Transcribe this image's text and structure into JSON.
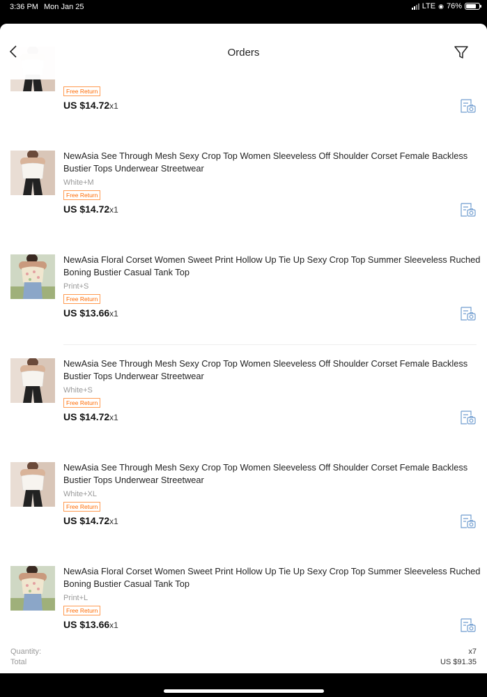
{
  "status_bar": {
    "time": "3:36 PM",
    "date": "Mon Jan 25",
    "network": "LTE",
    "battery": "76%",
    "battery_level": 0.76
  },
  "nav": {
    "title": "Orders",
    "back_icon": "chevron-left-icon",
    "filter_icon": "filter-funnel-icon"
  },
  "items": [
    {
      "title": "",
      "sku": "",
      "badge": "Free Return",
      "price": "US $14.72",
      "qty": "x1",
      "thumb": "white-corset"
    },
    {
      "title": "NewAsia See Through Mesh Sexy Crop Top Women Sleeveless Off Shoulder Corset Female Backless Bustier Tops Underwear Streetwear",
      "sku": "White+M",
      "badge": "Free Return",
      "price": "US $14.72",
      "qty": "x1",
      "thumb": "white-corset"
    },
    {
      "title": "NewAsia Floral Corset Women Sweet Print Hollow Up Tie Up Sexy Crop Top Summer Sleeveless Ruched Boning Bustier Casual Tank Top",
      "sku": "Print+S",
      "badge": "Free Return",
      "price": "US $13.66",
      "qty": "x1",
      "thumb": "floral-corset"
    },
    {
      "title": "NewAsia See Through Mesh Sexy Crop Top Women Sleeveless Off Shoulder Corset Female Backless Bustier Tops Underwear Streetwear",
      "sku": "White+S",
      "badge": "Free Return",
      "price": "US $14.72",
      "qty": "x1",
      "thumb": "white-corset"
    },
    {
      "title": "NewAsia See Through Mesh Sexy Crop Top Women Sleeveless Off Shoulder Corset Female Backless Bustier Tops Underwear Streetwear",
      "sku": "White+XL",
      "badge": "Free Return",
      "price": "US $14.72",
      "qty": "x1",
      "thumb": "white-corset"
    },
    {
      "title": "NewAsia Floral Corset Women Sweet Print Hollow Up Tie Up Sexy Crop Top Summer Sleeveless Ruched Boning Bustier Casual Tank Top",
      "sku": "Print+L",
      "badge": "Free Return",
      "price": "US $13.66",
      "qty": "x1",
      "thumb": "floral-corset"
    }
  ],
  "summary": {
    "quantity_label": "Quantity:",
    "quantity_value": "x7",
    "total_label": "Total",
    "total_value": "US $91.35"
  },
  "colors": {
    "accent": "#ff6a00",
    "review_icon": "#6f9ccf"
  }
}
